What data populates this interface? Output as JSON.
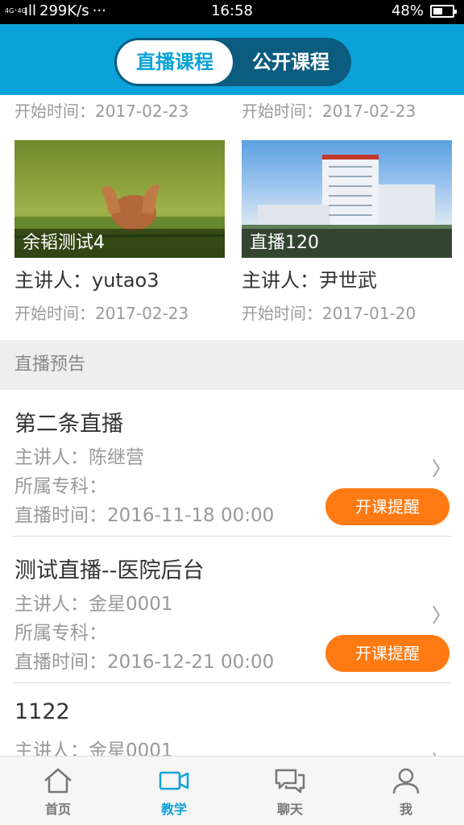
{
  "status_bar": {
    "network_small": "4G⁺4G",
    "signal": "ıll",
    "speed": "299K/s",
    "dots": "···",
    "time": "16:58",
    "battery_pct": "48%",
    "battery_level": 0.48
  },
  "header": {
    "tabs": [
      {
        "label": "直播课程",
        "active": true
      },
      {
        "label": "公开课程",
        "active": false
      }
    ]
  },
  "courses": {
    "top_dates": [
      "开始时间：2017-02-23",
      "开始时间：2017-02-23"
    ],
    "cards": [
      {
        "caption": "余韬测试4",
        "speaker": "主讲人：yutao3",
        "date": "开始时间：2017-02-23"
      },
      {
        "caption": "直播120",
        "speaker": "主讲人：尹世武",
        "date": "开始时间：2017-01-20"
      }
    ]
  },
  "preview_section": {
    "title": "直播预告",
    "items": [
      {
        "title": "第二条直播",
        "speaker": "主讲人：陈继营",
        "dept": "所属专科：",
        "time": "直播时间：2016-11-18 00:00",
        "button": "开课提醒"
      },
      {
        "title": "测试直播--医院后台",
        "speaker": "主讲人：金星0001",
        "dept": "所属专科：",
        "time": "直播时间：2016-12-21 00:00",
        "button": "开课提醒"
      },
      {
        "title": "1122",
        "speaker": "主讲人：金星0001",
        "dept": "",
        "time": "",
        "button": ""
      }
    ]
  },
  "tabbar": {
    "items": [
      {
        "label": "首页",
        "icon": "home-icon",
        "active": false
      },
      {
        "label": "教学",
        "icon": "video-camera-icon",
        "active": true
      },
      {
        "label": "聊天",
        "icon": "chat-bubbles-icon",
        "active": false
      },
      {
        "label": "我",
        "icon": "person-icon",
        "active": false
      }
    ]
  },
  "colors": {
    "brand": "#0aa2d8",
    "accent": "#ff7a12"
  }
}
